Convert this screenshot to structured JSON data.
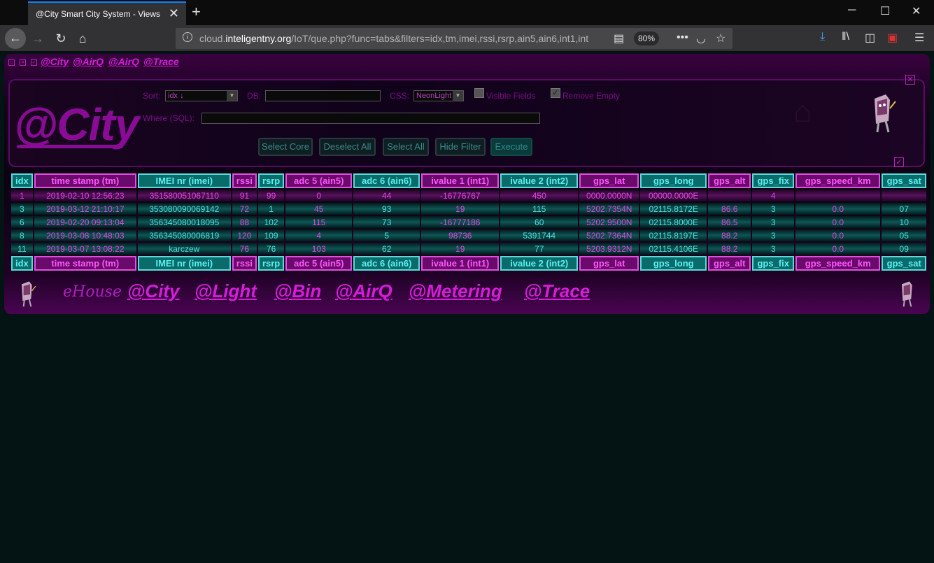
{
  "browser": {
    "tab_title": "@City Smart City System - Views",
    "url_prefix": "cloud.",
    "url_domain": "inteligentny.org",
    "url_rest": "/IoT/que.php?func=tabs&filters=idx,tm,imei,rssi,rsrp,ain5,ain6,int1,int",
    "zoom": "80%"
  },
  "top_links": [
    "@City",
    "@AirQ",
    "@AirQ",
    "@Trace"
  ],
  "filter": {
    "logo": "@City",
    "sort_label": "Sort:",
    "sort_value": "idx ↓",
    "db_label": "DB:",
    "css_label": "CSS:",
    "css_value": "NeonLight",
    "visible_fields_label": "Visible Fields",
    "remove_empty_label": "Remove Empty",
    "where_label": "Where (SQL):",
    "buttons": {
      "select_core": "Select Core",
      "deselect_all": "Deselect All",
      "select_all": "Select All",
      "hide_filter": "Hide Filter",
      "execute": "Execute"
    }
  },
  "table": {
    "headers": [
      "idx",
      "time stamp (tm)",
      "IMEI nr (imei)",
      "rssi",
      "rsrp",
      "adc 5 (ain5)",
      "adc 6 (ain6)",
      "ivalue 1 (int1)",
      "ivalue 2 (int2)",
      "gps_lat",
      "gps_long",
      "gps_alt",
      "gps_fix",
      "gps_speed_km",
      "gps_sat"
    ],
    "header_colors": [
      "c",
      "m",
      "c",
      "m",
      "c",
      "m",
      "c",
      "m",
      "c",
      "m",
      "c",
      "m",
      "c",
      "m",
      "c"
    ],
    "rows": [
      [
        "1",
        "2019-02-10 12:56:23",
        "351580051067110",
        "91",
        "99",
        "0",
        "44",
        "-16776767",
        "450",
        "0000.0000N",
        "00000.0000E",
        "",
        "4",
        "",
        ""
      ],
      [
        "3",
        "2019-03-12 21:10:17",
        "353080090069142",
        "72",
        "1",
        "45",
        "93",
        "19",
        "115",
        "5202.7354N",
        "02115.8172E",
        "86.6",
        "3",
        "0.0",
        "07"
      ],
      [
        "6",
        "2019-02-20 09:13:04",
        "356345080018095",
        "88",
        "102",
        "115",
        "73",
        "-16777186",
        "60",
        "5202.9500N",
        "02115.8000E",
        "86.5",
        "3",
        "0.0",
        "10"
      ],
      [
        "8",
        "2019-03-08 10:48:03",
        "356345080006819",
        "120",
        "109",
        "4",
        "5",
        "98736",
        "5391744",
        "5202.7364N",
        "02115.8197E",
        "88.2",
        "3",
        "0.0",
        "05"
      ],
      [
        "11",
        "2019-03-07 13:08:22",
        "karczew",
        "76",
        "76",
        "103",
        "62",
        "19",
        "77",
        "5203.9312N",
        "02115.4106E",
        "88.2",
        "3",
        "0.0",
        "09"
      ]
    ]
  },
  "footer_logos": {
    "ehouse": "eHouse",
    "items": [
      "@City",
      "@Light",
      "@Bin",
      "@AirQ",
      "@Metering",
      "@Trace"
    ]
  }
}
